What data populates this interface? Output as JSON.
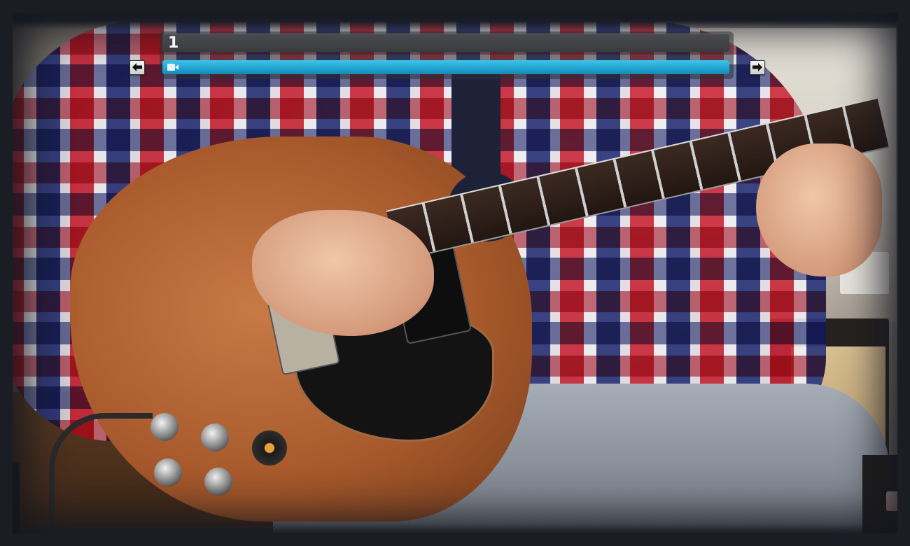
{
  "player": {
    "title": "1",
    "progress_fraction": 1.0,
    "progress_color": "#21a6d2",
    "progress_icon": "video-camera-icon",
    "prev_icon": "arrow-left-icon",
    "next_icon": "arrow-right-icon"
  },
  "video": {
    "subject": "guitar-video-frame"
  }
}
